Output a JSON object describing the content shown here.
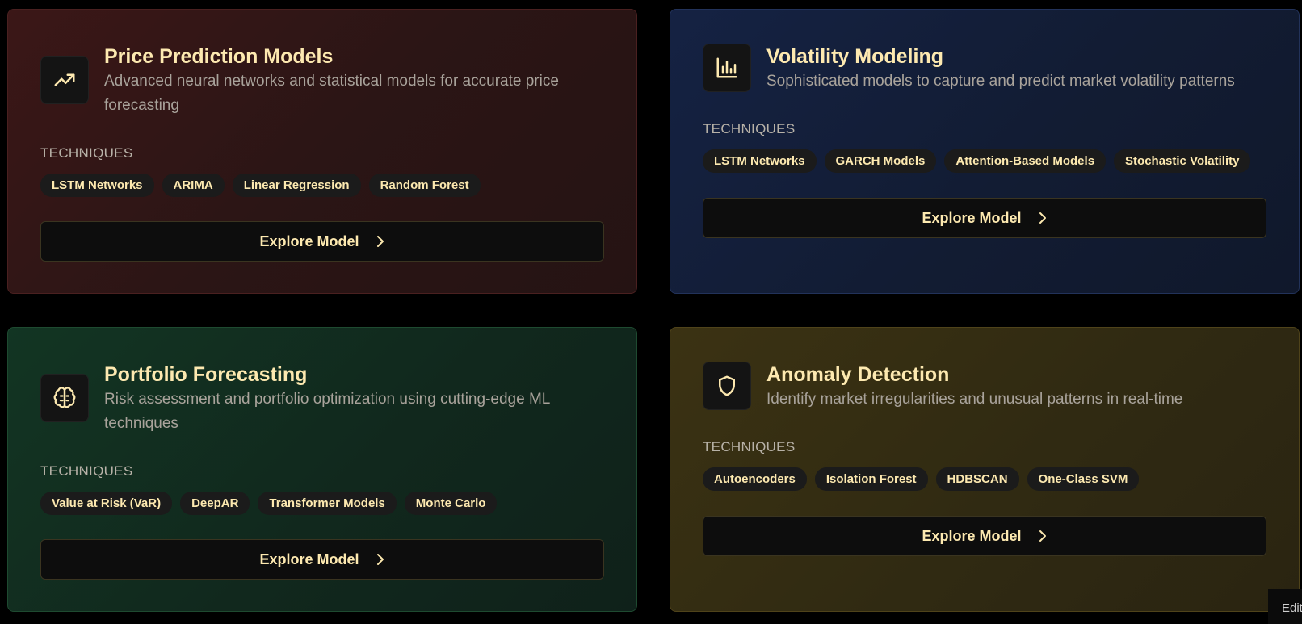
{
  "cards": [
    {
      "title": "Price Prediction Models",
      "description": "Advanced neural networks and statistical models for accurate price forecasting",
      "icon": "trending-up-icon",
      "accent": "#3b1717",
      "techniques_label": "TECHNIQUES",
      "techniques": [
        "LSTM Networks",
        "ARIMA",
        "Linear Regression",
        "Random Forest"
      ],
      "button": "Explore Model"
    },
    {
      "title": "Volatility Modeling",
      "description": "Sophisticated models to capture and predict market volatility patterns",
      "icon": "bar-chart-icon",
      "accent": "#152243",
      "techniques_label": "TECHNIQUES",
      "techniques": [
        "LSTM Networks",
        "GARCH Models",
        "Attention-Based Models",
        "Stochastic Volatility"
      ],
      "button": "Explore Model"
    },
    {
      "title": "Portfolio Forecasting",
      "description": "Risk assessment and portfolio optimization using cutting-edge ML techniques",
      "icon": "brain-icon",
      "accent": "#123523",
      "techniques_label": "TECHNIQUES",
      "techniques": [
        "Value at Risk (VaR)",
        "DeepAR",
        "Transformer Models",
        "Monte Carlo"
      ],
      "button": "Explore Model"
    },
    {
      "title": "Anomaly Detection",
      "description": "Identify market irregularities and unusual patterns in real-time",
      "icon": "shield-icon",
      "accent": "#3b3213",
      "techniques_label": "TECHNIQUES",
      "techniques": [
        "Autoencoders",
        "Isolation Forest",
        "HDBSCAN",
        "One-Class SVM"
      ],
      "button": "Explore Model"
    }
  ],
  "edit_tab": "Edit",
  "colors": {
    "title": "#fde9b0",
    "description": "#a9a39b",
    "chip_bg": "#1b1b1b"
  }
}
